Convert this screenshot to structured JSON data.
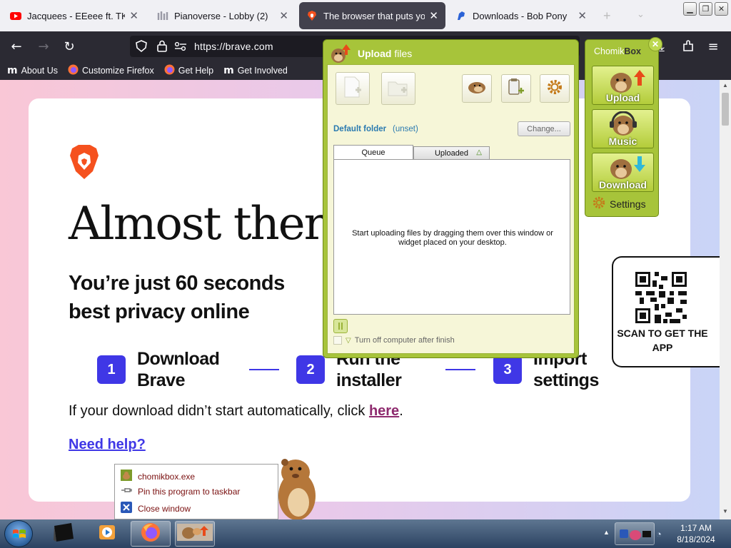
{
  "browser": {
    "tabs": [
      {
        "title": "Jacquees - EEeee ft. TK Kravitz",
        "favicon": "youtube-icon"
      },
      {
        "title": "Pianoverse - Lobby (2)",
        "favicon": "pianoverse-icon"
      },
      {
        "title": "The browser that puts you first",
        "favicon": "brave-icon",
        "active": true
      },
      {
        "title": "Downloads - Bob Pony",
        "favicon": "bobpony-icon"
      }
    ],
    "url": "https://brave.com",
    "bookmarks": [
      {
        "label": "About Us",
        "icon": "mozilla-icon"
      },
      {
        "label": "Customize Firefox",
        "icon": "firefox-icon"
      },
      {
        "label": "Get Help",
        "icon": "firefox-icon"
      },
      {
        "label": "Get Involved",
        "icon": "mozilla-icon"
      }
    ]
  },
  "page": {
    "headline": "Almost ther",
    "subheadline": "You’re just 60 seconds best privacy online",
    "steps": [
      {
        "num": "1",
        "label": "Download Brave"
      },
      {
        "num": "2",
        "label": "Run the installer"
      },
      {
        "num": "3",
        "label": "Import settings"
      }
    ],
    "retry_text": "If your download didn’t start automatically, click ",
    "retry_link": "here",
    "retry_end": ".",
    "help_link": "Need help?",
    "qr_label": "SCAN TO GET THE APP"
  },
  "upload_window": {
    "title_bold": "Upload",
    "title_rest": " files",
    "default_folder_label": "Default folder",
    "default_folder_value": "(unset)",
    "change_button": "Change...",
    "tabs": [
      "Queue",
      "Uploaded"
    ],
    "queue_message": "Start uploading files by dragging them over this window or widget placed on your desktop.",
    "turn_off_label": "Turn off computer after finish"
  },
  "widget": {
    "title_a": "Chomik",
    "title_b": "Box",
    "buttons": [
      "Upload",
      "Music",
      "Download"
    ],
    "settings": "Settings"
  },
  "jump_list": {
    "items": [
      {
        "label": "chomikbox.exe",
        "icon": "chomikbox-icon"
      },
      {
        "label": "Pin this program to taskbar",
        "icon": "pin-icon"
      },
      {
        "label": "Close window",
        "icon": "close-window-icon"
      }
    ]
  },
  "taskbar": {
    "time": "1:17 AM",
    "date": "8/18/2024"
  },
  "colors": {
    "brave_blue": "#3f37e6",
    "chomik_green": "#a7c43a",
    "link_purple": "#8e2a6e"
  }
}
